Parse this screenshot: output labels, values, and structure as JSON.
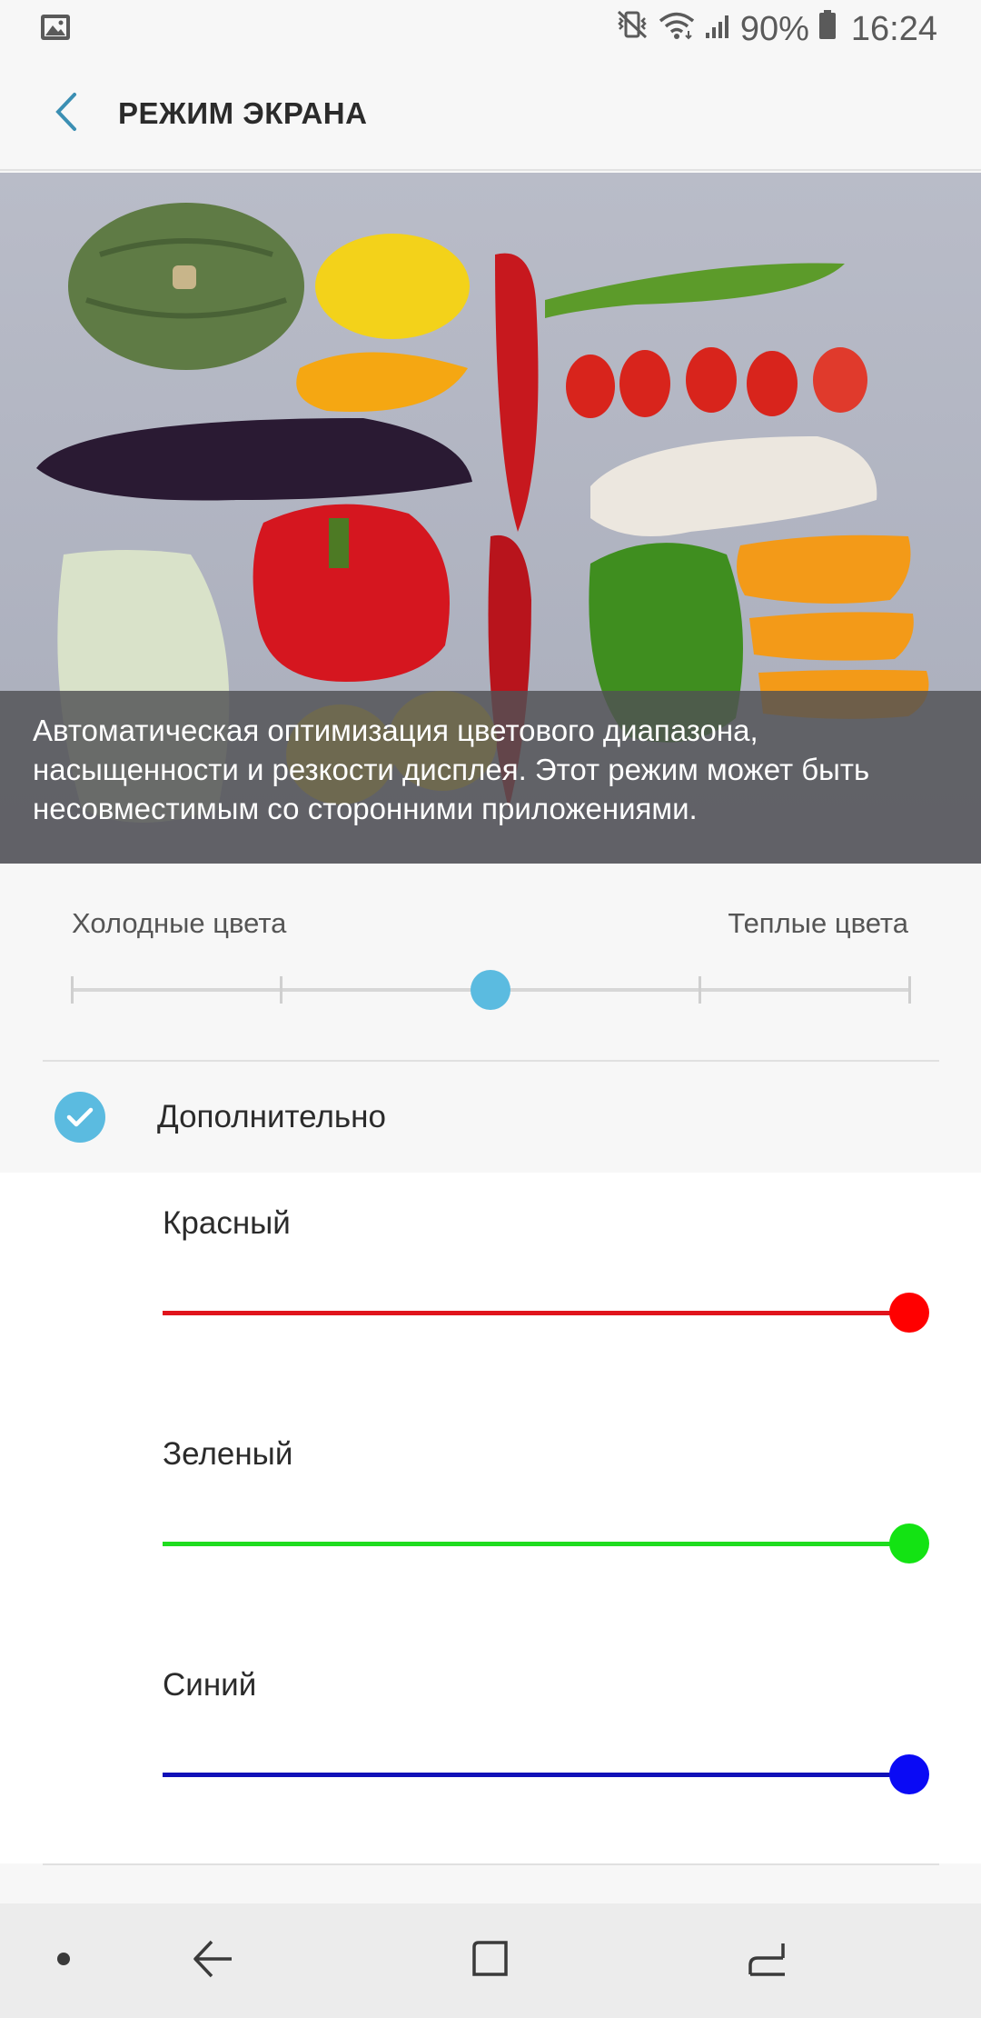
{
  "status_bar": {
    "battery": "90%",
    "time": "16:24",
    "icons": [
      "gallery-icon",
      "vibrate-off-icon",
      "wifi-icon",
      "signal-icon",
      "battery-icon"
    ]
  },
  "header": {
    "title": "РЕЖИМ ЭКРАНА",
    "back_icon": "chevron-left-icon"
  },
  "preview": {
    "caption": "Автоматическая оптимизация цветового диапазона, насыщенности и резкости дисплея. Этот режим может быть несовместимым со сторонними приложениями."
  },
  "tone": {
    "cool_label": "Холодные цвета",
    "warm_label": "Теплые цвета",
    "steps": 5,
    "selected_step": 2
  },
  "advanced": {
    "label": "Дополнительно",
    "checked": true
  },
  "rgb": [
    {
      "key": "red",
      "label": "Красный",
      "color": "#ff0000",
      "track_color": "#e0141c",
      "value": 1.0
    },
    {
      "key": "green",
      "label": "Зеленый",
      "color": "#13e313",
      "track_color": "#1fdc1f",
      "value": 1.0
    },
    {
      "key": "blue",
      "label": "Синий",
      "color": "#0a0af5",
      "track_color": "#1010b8",
      "value": 1.0
    }
  ],
  "colors": {
    "accent": "#5bbbe0",
    "background": "#f7f7f7",
    "nav_background": "#ececec"
  },
  "nav_bar": {
    "items": [
      "dot-icon",
      "back-arrow-icon",
      "home-square-icon",
      "recents-icon"
    ]
  }
}
